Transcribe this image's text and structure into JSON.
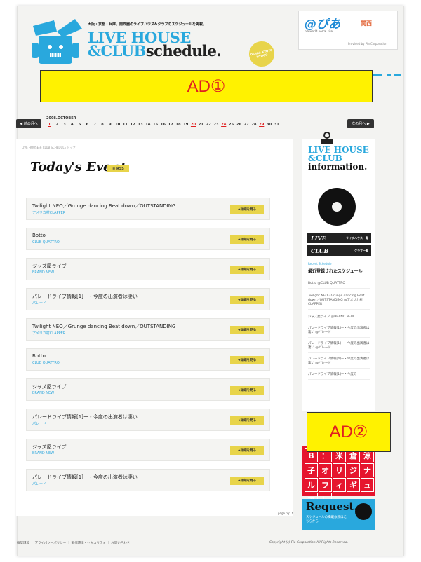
{
  "header": {
    "catch_copy": "大阪・京都・兵庫。関西圏のライブハウス&クラブのスケジュールを掲載。",
    "logo_line1": "LIVE HOUSE",
    "logo_line2_a": "&CLUB",
    "logo_line2_b": "schedule.",
    "seal_text": "OSAKA KYOTO HYOGO",
    "pia_logo": "@ぴあ",
    "pia_region": "関西",
    "pia_tagline": "pia world portal site",
    "pia_credit": "Provided by Pia Corporation"
  },
  "ads": {
    "ad1": "AD①",
    "ad2": "AD②"
  },
  "calendar": {
    "prev_label": "前の月へ",
    "next_label": "次の月へ",
    "month_label": "2008.OCTOBER",
    "days": [
      "1",
      "2",
      "3",
      "4",
      "5",
      "6",
      "7",
      "8",
      "9",
      "10",
      "11",
      "12",
      "13",
      "14",
      "15",
      "16",
      "17",
      "18",
      "19",
      "20",
      "21",
      "22",
      "23",
      "24",
      "25",
      "26",
      "27",
      "28",
      "29",
      "30",
      "31"
    ],
    "highlighted": [
      1,
      20,
      24,
      29
    ]
  },
  "main": {
    "breadcrumb": "LIVE HOUSE & CLUB SCHEDULE トップ",
    "title": "Today's Event",
    "rss_label": "RSS",
    "detail_button_label": "詳細を見る",
    "events": [
      {
        "title": "Twilight NEO／Grunge dancing Beat down／OUTSTANDING",
        "venue": "アメリカ村CLAPPER"
      },
      {
        "title": "Botto",
        "venue": "CLUB QUATTRO"
      },
      {
        "title": "ジャズ屋ライブ",
        "venue": "BRAND NEW"
      },
      {
        "title": "パレードライブ情報[1]ー・今度の出演者は凄い",
        "venue": "パレード"
      },
      {
        "title": "Twilight NEO／Grunge dancing Beat down／OUTSTANDING",
        "venue": "アメリカ村CLAPPER"
      },
      {
        "title": "Botto",
        "venue": "CLUB QUATTRO"
      },
      {
        "title": "ジャズ屋ライブ",
        "venue": "BRAND NEW"
      },
      {
        "title": "パレードライブ情報[1]ー・今度の出演者は凄い",
        "venue": "パレード"
      },
      {
        "title": "ジャズ屋ライブ",
        "venue": "BRAND NEW"
      },
      {
        "title": "パレードライブ情報[1]ー・今度の出演者は凄い",
        "venue": "パレード"
      }
    ],
    "page_top": "page top"
  },
  "sidebar": {
    "info_line1": "LIVE HOUSE",
    "info_line2": "&CLUB",
    "info_line3": "information.",
    "nav_live": "LIVE",
    "nav_live_sub": "ライブハウス一覧",
    "nav_club": "CLUB",
    "nav_club_sub": "クラブ一覧",
    "recent_en": "Recent Schedule",
    "recent_jp": "最近登録されたスケジュール",
    "recent_items": [
      "Botto @CLUB QUATTRO",
      "Twilight NEO／Grunge dancing Beat down／OUTSTANDING @アメリカ村CLAPPER",
      "ジャズ屋ライブ @BRAND NEW",
      "パレードライブ情報[1]ー・今度の出演者は凄い @パレード",
      "パレードライブ情報[1]ー・今度の出演者は凄い @パレード",
      "パレードライブ情報[4]ー・今度の出演者は凄い @パレード",
      "パレードライブ情報[1]ー・今度の"
    ],
    "figure_chars": [
      "B",
      "：",
      "米",
      "倉",
      "涼",
      "子",
      "オ",
      "リ",
      "ジ",
      "ナ",
      "ル",
      "フ",
      "ィ",
      "ギ",
      "ュ",
      "ア",
      "！"
    ],
    "request_title": "Request.",
    "request_sub": "スケジュールの掲載依頼はこちらから"
  },
  "footer": {
    "links": "推奨環境 ｜ プライバシーポリシー ｜ 動作環境・セキュリティ ｜ お問い合わせ",
    "copyright": "Copyright (c) Pia Corporation.All Rights Reserved."
  },
  "colors": {
    "accent_blue": "#29a8dd",
    "accent_yellow": "#e8d44a",
    "ad_yellow": "#fff200",
    "figure_red": "#e6152e"
  }
}
